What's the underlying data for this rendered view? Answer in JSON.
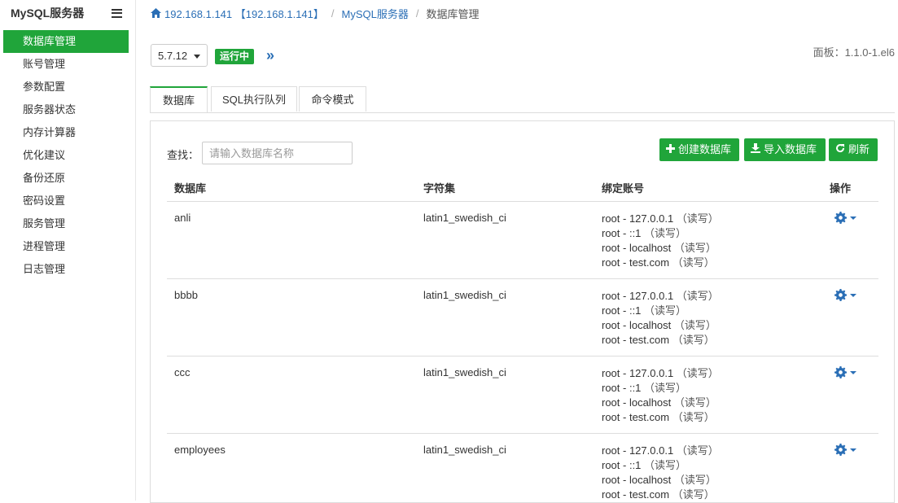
{
  "sidebar": {
    "title": "MySQL服务器",
    "items": [
      {
        "label": "数据库管理",
        "active": true
      },
      {
        "label": "账号管理"
      },
      {
        "label": "参数配置"
      },
      {
        "label": "服务器状态"
      },
      {
        "label": "内存计算器"
      },
      {
        "label": "优化建议"
      },
      {
        "label": "备份还原"
      },
      {
        "label": "密码设置"
      },
      {
        "label": "服务管理"
      },
      {
        "label": "进程管理"
      },
      {
        "label": "日志管理"
      }
    ]
  },
  "breadcrumb": {
    "host": "192.168.1.141 【192.168.1.141】",
    "parent": "MySQL服务器",
    "current": "数据库管理",
    "separator": "/"
  },
  "version": {
    "selected": "5.7.12",
    "status": "运行中",
    "panel": "面板：1.1.0-1.el6"
  },
  "tabs": [
    {
      "label": "数据库",
      "active": true
    },
    {
      "label": "SQL执行队列"
    },
    {
      "label": "命令模式"
    }
  ],
  "search": {
    "label": "查找：",
    "placeholder": "请输入数据库名称"
  },
  "actions": {
    "create": "创建数据库",
    "import": "导入数据库",
    "refresh": "刷新"
  },
  "table": {
    "headers": [
      "数据库",
      "字符集",
      "绑定账号",
      "操作"
    ],
    "rows": [
      {
        "name": "anli",
        "charset": "latin1_swedish_ci",
        "accounts": [
          "root - 127.0.0.1",
          "root - ::1",
          "root - localhost",
          "root - test.com"
        ]
      },
      {
        "name": "bbbb",
        "charset": "latin1_swedish_ci",
        "accounts": [
          "root - 127.0.0.1",
          "root - ::1",
          "root - localhost",
          "root - test.com"
        ]
      },
      {
        "name": "ccc",
        "charset": "latin1_swedish_ci",
        "accounts": [
          "root - 127.0.0.1",
          "root - ::1",
          "root - localhost",
          "root - test.com"
        ]
      },
      {
        "name": "employees",
        "charset": "latin1_swedish_ci",
        "accounts": [
          "root - 127.0.0.1",
          "root - ::1",
          "root - localhost",
          "root - test.com"
        ]
      }
    ],
    "rw_label": "（读写）"
  },
  "colors": {
    "accent": "#20a53a",
    "link": "#2b6fb6"
  },
  "icons": {
    "home": "home-icon",
    "menu": "hamburger-icon",
    "expand": "double-chevron-right-icon",
    "create": "plus-icon",
    "import": "import-icon",
    "refresh": "refresh-icon",
    "ops": "gear-icon"
  }
}
